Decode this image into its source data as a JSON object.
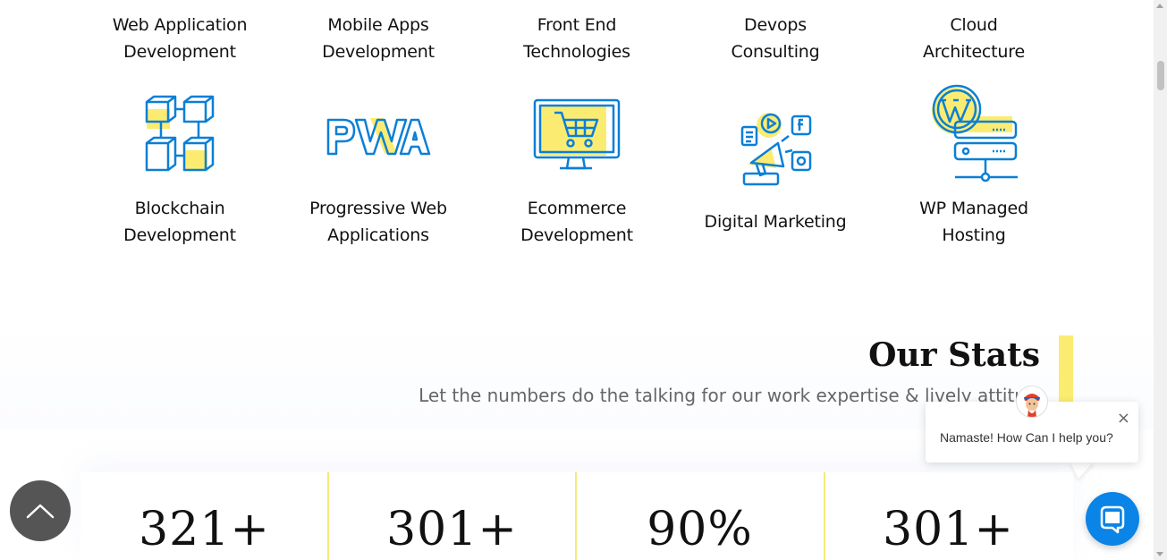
{
  "services": {
    "row1": [
      {
        "label1": "Web Application",
        "label2": "Development"
      },
      {
        "label1": "Mobile Apps",
        "label2": "Development"
      },
      {
        "label1": "Front End",
        "label2": "Technologies"
      },
      {
        "label1": "Devops",
        "label2": "Consulting"
      },
      {
        "label1": "Cloud",
        "label2": "Architecture"
      }
    ],
    "row2": [
      {
        "label1": "Blockchain",
        "label2": "Development",
        "icon": "blockchain-icon"
      },
      {
        "label1": "Progressive Web",
        "label2": "Applications",
        "icon": "pwa-icon"
      },
      {
        "label1": "Ecommerce",
        "label2": "Development",
        "icon": "ecommerce-icon"
      },
      {
        "label1": "Digital Marketing",
        "label2": "",
        "icon": "digital-marketing-icon"
      },
      {
        "label1": "WP Managed",
        "label2": "Hosting",
        "icon": "wordpress-hosting-icon"
      }
    ],
    "pwa_text": "PWA"
  },
  "stats": {
    "title": "Our Stats",
    "subtitle": "Let the numbers do the talking for our work expertise & lively attitu",
    "values": [
      "321+",
      "301+",
      "90%",
      "301+"
    ]
  },
  "chat": {
    "greeting": "Namaste! How Can I help you?",
    "close_icon": "×"
  },
  "colors": {
    "accent_yellow": "#fbec71",
    "icon_blue": "#0a7fd6",
    "chat_blue": "#0a84e6",
    "scroll_top_bg": "#555555"
  }
}
